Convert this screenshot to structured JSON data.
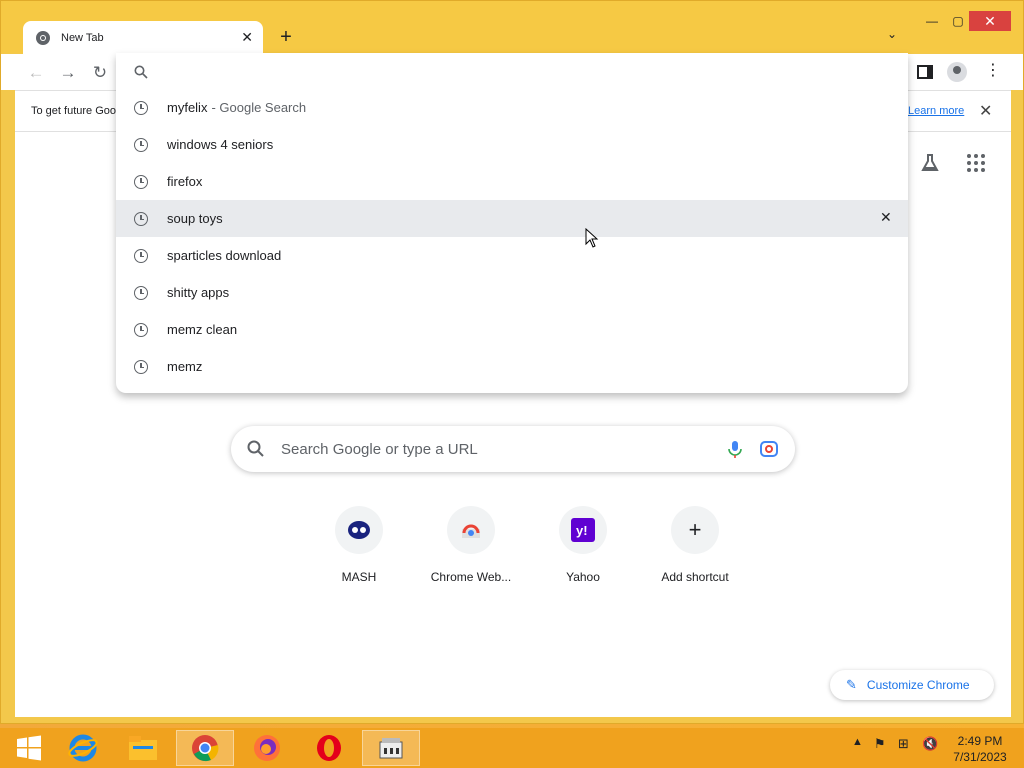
{
  "window": {
    "tab_title": "New Tab",
    "new_tab_symbol": "+"
  },
  "toolbar": {
    "back_icon": "back-arrow-icon",
    "forward_icon": "forward-arrow-icon",
    "reload_icon": "reload-icon"
  },
  "infobar": {
    "text": "To get future Goo",
    "link": "Learn more"
  },
  "omnibox": {
    "value": "",
    "suggestions": [
      {
        "text": "myfelix",
        "suffix": "- Google Search"
      },
      {
        "text": "windows 4 seniors"
      },
      {
        "text": "firefox"
      },
      {
        "text": "soup toys",
        "highlighted": true
      },
      {
        "text": "sparticles download"
      },
      {
        "text": "shitty apps"
      },
      {
        "text": "memz clean"
      },
      {
        "text": "memz"
      }
    ]
  },
  "ntp": {
    "search_placeholder": "Search Google or type a URL",
    "shortcuts": [
      {
        "label": "MASH",
        "icon": "mash-icon"
      },
      {
        "label": "Chrome Web...",
        "icon": "chrome-web-store-icon"
      },
      {
        "label": "Yahoo",
        "icon": "yahoo-icon"
      },
      {
        "label": "Add shortcut",
        "icon": "plus-icon"
      }
    ],
    "customize_label": "Customize Chrome"
  },
  "taskbar": {
    "time": "2:49 PM",
    "date": "7/31/2023"
  },
  "colors": {
    "accent": "#1a73e8",
    "frame": "#f6c944",
    "taskbar": "#f0a21e"
  }
}
